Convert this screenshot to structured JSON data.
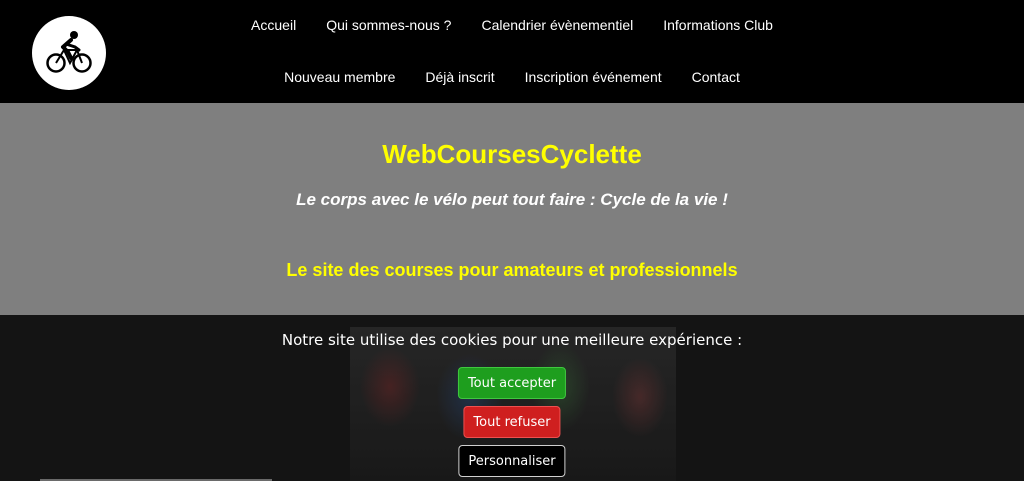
{
  "header": {
    "logo_icon": "cyclist-icon",
    "nav_row1": [
      "Accueil",
      "Qui sommes-nous ?",
      "Calendrier évènementiel",
      "Informations Club"
    ],
    "nav_row2": [
      "Nouveau membre",
      "Déjà inscrit",
      "Inscription événement",
      "Contact"
    ]
  },
  "hero": {
    "title": "WebCoursesCyclette",
    "tagline": "Le corps avec le vélo peut tout faire : Cycle de la vie !",
    "subtitle": "Le site des courses pour amateurs et professionnels"
  },
  "cookie_banner": {
    "message": "Notre site utilise des cookies pour une meilleure expérience :",
    "accept_label": "Tout accepter",
    "refuse_label": "Tout refuser",
    "customize_label": "Personnaliser"
  },
  "colors": {
    "title_yellow": "#ffff00",
    "hero_gray": "#7f7f7f",
    "accept_green": "#1e9e1e",
    "refuse_red": "#cf1f1f"
  }
}
